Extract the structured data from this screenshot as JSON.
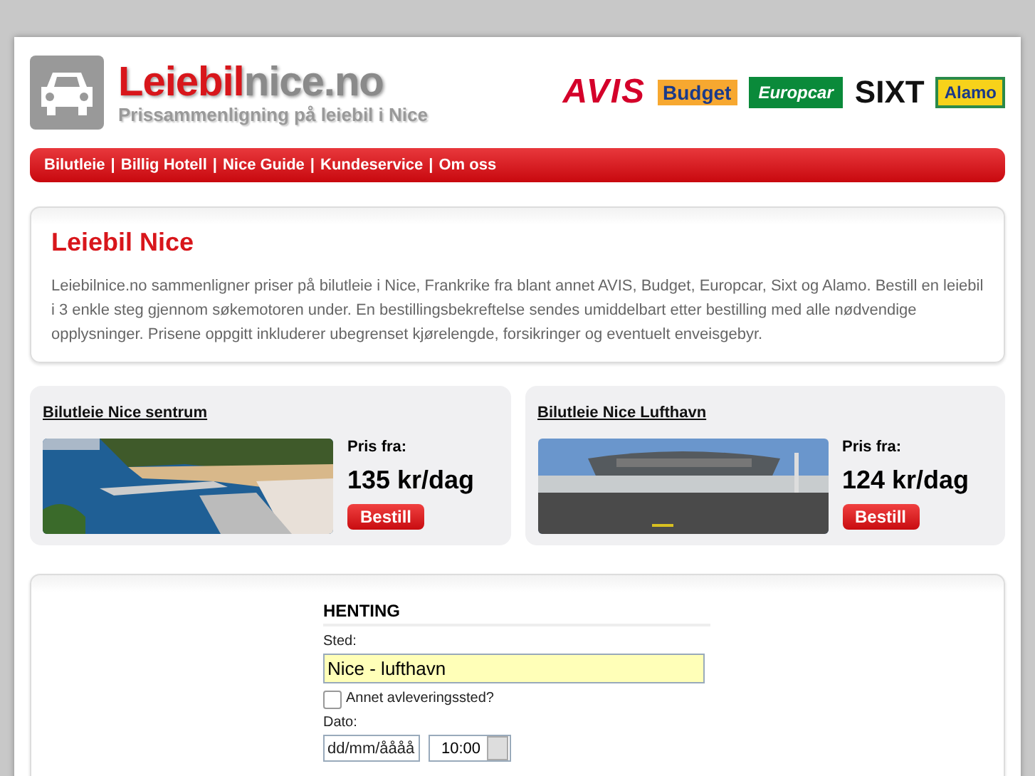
{
  "logo": {
    "title_red": "Leiebil",
    "title_gray": "nice.no",
    "tagline": "Prissammenligning på leiebil i Nice"
  },
  "brands": [
    {
      "label": "AVIS",
      "kind": "avis"
    },
    {
      "label": "Budget",
      "kind": "budget"
    },
    {
      "label": "Europcar",
      "kind": "europcar"
    },
    {
      "label": "SIXT",
      "kind": "sixt"
    },
    {
      "label": "Alamo",
      "kind": "alamo"
    }
  ],
  "nav": {
    "separator": "|",
    "items": [
      "Bilutleie",
      "Billig Hotell",
      "Nice Guide",
      "Kundeservice",
      "Om oss"
    ]
  },
  "intro": {
    "title": "Leiebil Nice",
    "text": "Leiebilnice.no sammenligner priser på bilutleie i Nice, Frankrike fra blant annet AVIS, Budget, Europcar, Sixt og Alamo. Bestill en leiebil i 3 enkle steg gjennom søkemotoren under. En bestillingsbekreftelse sendes umiddelbart etter bestilling med alle nødvendige opplysninger. Prisene oppgitt inkluderer ubegrenset kjørelengde, forsikringer og eventuelt enveisgebyr."
  },
  "offers": [
    {
      "title": "Bilutleie Nice sentrum",
      "price_label": "Pris fra:",
      "price": "135 kr/dag",
      "button": "Bestill"
    },
    {
      "title": "Bilutleie Nice Lufthavn",
      "price_label": "Pris fra:",
      "price": "124 kr/dag",
      "button": "Bestill"
    }
  ],
  "form": {
    "heading": "HENTING",
    "place_label": "Sted:",
    "place_value": "Nice - lufthavn",
    "other_dropoff": {
      "label": "Annet avleveringssted?",
      "checked": false
    },
    "date_label": "Dato:",
    "date_placeholder": "dd/mm/åååå",
    "time": "10:00"
  }
}
